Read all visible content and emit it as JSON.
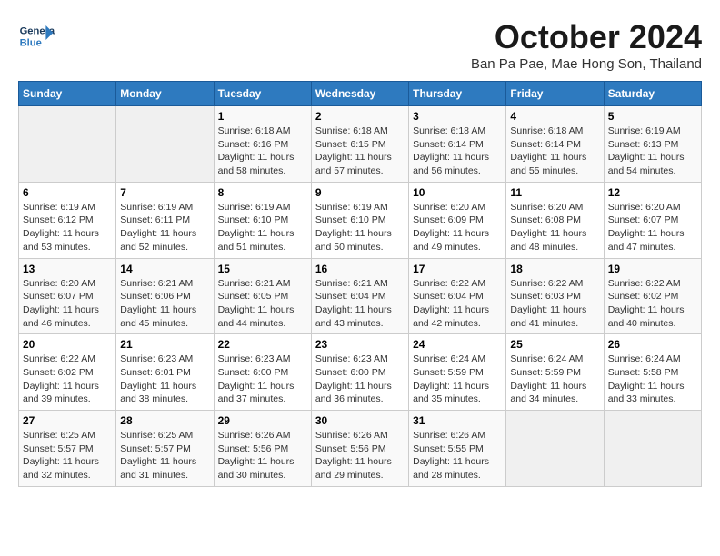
{
  "header": {
    "logo_general": "General",
    "logo_blue": "Blue",
    "month_title": "October 2024",
    "subtitle": "Ban Pa Pae, Mae Hong Son, Thailand"
  },
  "weekdays": [
    "Sunday",
    "Monday",
    "Tuesday",
    "Wednesday",
    "Thursday",
    "Friday",
    "Saturday"
  ],
  "weeks": [
    [
      {
        "day": "",
        "sunrise": "",
        "sunset": "",
        "daylight": ""
      },
      {
        "day": "",
        "sunrise": "",
        "sunset": "",
        "daylight": ""
      },
      {
        "day": "1",
        "sunrise": "Sunrise: 6:18 AM",
        "sunset": "Sunset: 6:16 PM",
        "daylight": "Daylight: 11 hours and 58 minutes."
      },
      {
        "day": "2",
        "sunrise": "Sunrise: 6:18 AM",
        "sunset": "Sunset: 6:15 PM",
        "daylight": "Daylight: 11 hours and 57 minutes."
      },
      {
        "day": "3",
        "sunrise": "Sunrise: 6:18 AM",
        "sunset": "Sunset: 6:14 PM",
        "daylight": "Daylight: 11 hours and 56 minutes."
      },
      {
        "day": "4",
        "sunrise": "Sunrise: 6:18 AM",
        "sunset": "Sunset: 6:14 PM",
        "daylight": "Daylight: 11 hours and 55 minutes."
      },
      {
        "day": "5",
        "sunrise": "Sunrise: 6:19 AM",
        "sunset": "Sunset: 6:13 PM",
        "daylight": "Daylight: 11 hours and 54 minutes."
      }
    ],
    [
      {
        "day": "6",
        "sunrise": "Sunrise: 6:19 AM",
        "sunset": "Sunset: 6:12 PM",
        "daylight": "Daylight: 11 hours and 53 minutes."
      },
      {
        "day": "7",
        "sunrise": "Sunrise: 6:19 AM",
        "sunset": "Sunset: 6:11 PM",
        "daylight": "Daylight: 11 hours and 52 minutes."
      },
      {
        "day": "8",
        "sunrise": "Sunrise: 6:19 AM",
        "sunset": "Sunset: 6:10 PM",
        "daylight": "Daylight: 11 hours and 51 minutes."
      },
      {
        "day": "9",
        "sunrise": "Sunrise: 6:19 AM",
        "sunset": "Sunset: 6:10 PM",
        "daylight": "Daylight: 11 hours and 50 minutes."
      },
      {
        "day": "10",
        "sunrise": "Sunrise: 6:20 AM",
        "sunset": "Sunset: 6:09 PM",
        "daylight": "Daylight: 11 hours and 49 minutes."
      },
      {
        "day": "11",
        "sunrise": "Sunrise: 6:20 AM",
        "sunset": "Sunset: 6:08 PM",
        "daylight": "Daylight: 11 hours and 48 minutes."
      },
      {
        "day": "12",
        "sunrise": "Sunrise: 6:20 AM",
        "sunset": "Sunset: 6:07 PM",
        "daylight": "Daylight: 11 hours and 47 minutes."
      }
    ],
    [
      {
        "day": "13",
        "sunrise": "Sunrise: 6:20 AM",
        "sunset": "Sunset: 6:07 PM",
        "daylight": "Daylight: 11 hours and 46 minutes."
      },
      {
        "day": "14",
        "sunrise": "Sunrise: 6:21 AM",
        "sunset": "Sunset: 6:06 PM",
        "daylight": "Daylight: 11 hours and 45 minutes."
      },
      {
        "day": "15",
        "sunrise": "Sunrise: 6:21 AM",
        "sunset": "Sunset: 6:05 PM",
        "daylight": "Daylight: 11 hours and 44 minutes."
      },
      {
        "day": "16",
        "sunrise": "Sunrise: 6:21 AM",
        "sunset": "Sunset: 6:04 PM",
        "daylight": "Daylight: 11 hours and 43 minutes."
      },
      {
        "day": "17",
        "sunrise": "Sunrise: 6:22 AM",
        "sunset": "Sunset: 6:04 PM",
        "daylight": "Daylight: 11 hours and 42 minutes."
      },
      {
        "day": "18",
        "sunrise": "Sunrise: 6:22 AM",
        "sunset": "Sunset: 6:03 PM",
        "daylight": "Daylight: 11 hours and 41 minutes."
      },
      {
        "day": "19",
        "sunrise": "Sunrise: 6:22 AM",
        "sunset": "Sunset: 6:02 PM",
        "daylight": "Daylight: 11 hours and 40 minutes."
      }
    ],
    [
      {
        "day": "20",
        "sunrise": "Sunrise: 6:22 AM",
        "sunset": "Sunset: 6:02 PM",
        "daylight": "Daylight: 11 hours and 39 minutes."
      },
      {
        "day": "21",
        "sunrise": "Sunrise: 6:23 AM",
        "sunset": "Sunset: 6:01 PM",
        "daylight": "Daylight: 11 hours and 38 minutes."
      },
      {
        "day": "22",
        "sunrise": "Sunrise: 6:23 AM",
        "sunset": "Sunset: 6:00 PM",
        "daylight": "Daylight: 11 hours and 37 minutes."
      },
      {
        "day": "23",
        "sunrise": "Sunrise: 6:23 AM",
        "sunset": "Sunset: 6:00 PM",
        "daylight": "Daylight: 11 hours and 36 minutes."
      },
      {
        "day": "24",
        "sunrise": "Sunrise: 6:24 AM",
        "sunset": "Sunset: 5:59 PM",
        "daylight": "Daylight: 11 hours and 35 minutes."
      },
      {
        "day": "25",
        "sunrise": "Sunrise: 6:24 AM",
        "sunset": "Sunset: 5:59 PM",
        "daylight": "Daylight: 11 hours and 34 minutes."
      },
      {
        "day": "26",
        "sunrise": "Sunrise: 6:24 AM",
        "sunset": "Sunset: 5:58 PM",
        "daylight": "Daylight: 11 hours and 33 minutes."
      }
    ],
    [
      {
        "day": "27",
        "sunrise": "Sunrise: 6:25 AM",
        "sunset": "Sunset: 5:57 PM",
        "daylight": "Daylight: 11 hours and 32 minutes."
      },
      {
        "day": "28",
        "sunrise": "Sunrise: 6:25 AM",
        "sunset": "Sunset: 5:57 PM",
        "daylight": "Daylight: 11 hours and 31 minutes."
      },
      {
        "day": "29",
        "sunrise": "Sunrise: 6:26 AM",
        "sunset": "Sunset: 5:56 PM",
        "daylight": "Daylight: 11 hours and 30 minutes."
      },
      {
        "day": "30",
        "sunrise": "Sunrise: 6:26 AM",
        "sunset": "Sunset: 5:56 PM",
        "daylight": "Daylight: 11 hours and 29 minutes."
      },
      {
        "day": "31",
        "sunrise": "Sunrise: 6:26 AM",
        "sunset": "Sunset: 5:55 PM",
        "daylight": "Daylight: 11 hours and 28 minutes."
      },
      {
        "day": "",
        "sunrise": "",
        "sunset": "",
        "daylight": ""
      },
      {
        "day": "",
        "sunrise": "",
        "sunset": "",
        "daylight": ""
      }
    ]
  ]
}
